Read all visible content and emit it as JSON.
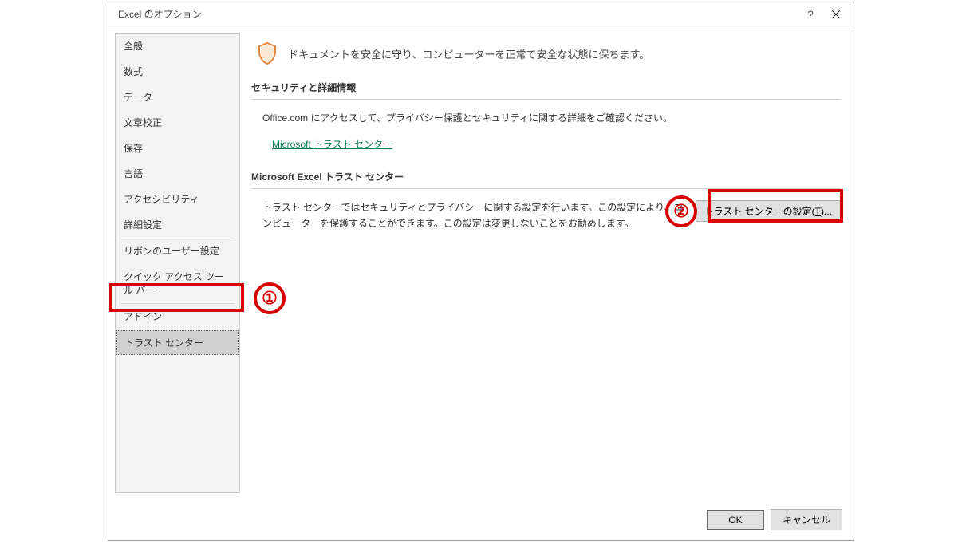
{
  "dialog": {
    "title": "Excel のオプション"
  },
  "sidebar": {
    "items": [
      "全般",
      "数式",
      "データ",
      "文章校正",
      "保存",
      "言語",
      "アクセシビリティ",
      "詳細設定",
      "リボンのユーザー設定",
      "クイック アクセス ツール バー",
      "アドイン",
      "トラスト センター"
    ]
  },
  "content": {
    "header_text": "ドキュメントを安全に守り、コンピューターを正常で安全な状態に保ちます。",
    "section1_title": "セキュリティと詳細情報",
    "section1_body": "Office.com にアクセスして、プライバシー保護とセキュリティに関する詳細をご確認ください。",
    "section1_link": "Microsoft トラスト センター",
    "section2_title": "Microsoft Excel トラスト センター",
    "section2_body": "トラスト センターではセキュリティとプライバシーに関する設定を行います。この設定により、コンピューターを保護することができます。この設定は変更しないことをお勧めします。",
    "trust_button_prefix": "トラスト センターの設定(",
    "trust_button_key": "T",
    "trust_button_suffix": ")..."
  },
  "buttons": {
    "ok": "OK",
    "cancel": "キャンセル"
  },
  "annotations": {
    "one": "①",
    "two": "②"
  }
}
